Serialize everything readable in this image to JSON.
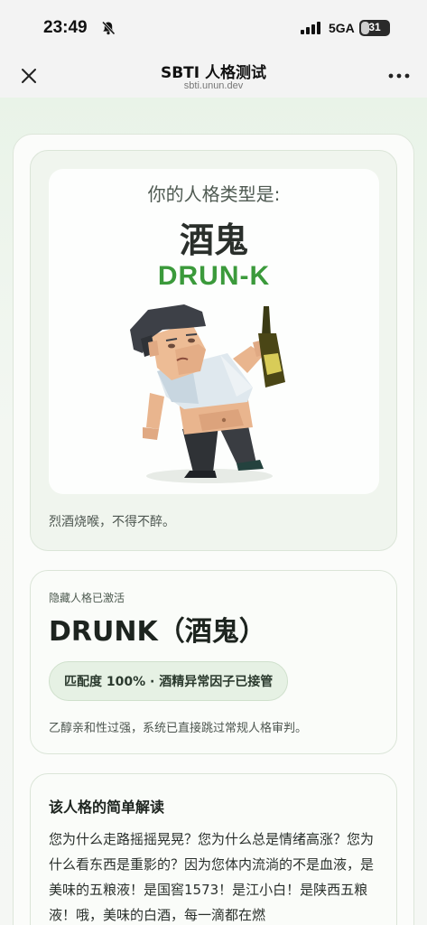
{
  "status": {
    "time": "23:49",
    "network": "5GA",
    "battery": "31",
    "battery_level": 0.31,
    "icons": [
      "bell-off-icon",
      "signal-icon",
      "battery-icon"
    ]
  },
  "nav": {
    "title": "SBTI 人格测试",
    "subtitle": "sbti.unun.dev",
    "icons": [
      "close-icon",
      "more-icon"
    ]
  },
  "result": {
    "label": "你的人格类型是:",
    "type_cn": "酒鬼",
    "type_code": "DRUN-K",
    "tagline": "烈酒烧喉，不得不醉。",
    "illustration": "drunk-man-with-bottle"
  },
  "hidden": {
    "label": "隐藏人格已激活",
    "title": "DRUNK（酒鬼）",
    "match": "匹配度 100% · 酒精异常因子已接管",
    "desc": "乙醇亲和性过强，系统已直接跳过常规人格审判。"
  },
  "reading": {
    "title": "该人格的简单解读",
    "body": "您为什么走路摇摇晃晃？您为什么总是情绪高涨？您为什么看东西是重影的？因为您体内流淌的不是血液，是美味的五粮液！是国窖1573！是江小白！是陕西五粮液！哦，美味的白酒，每一滴都在燃"
  },
  "colors": {
    "accent_green": "#3b9a3b",
    "pill_bg": "#e6f1e4",
    "page_bg": "#f2f6f1"
  }
}
